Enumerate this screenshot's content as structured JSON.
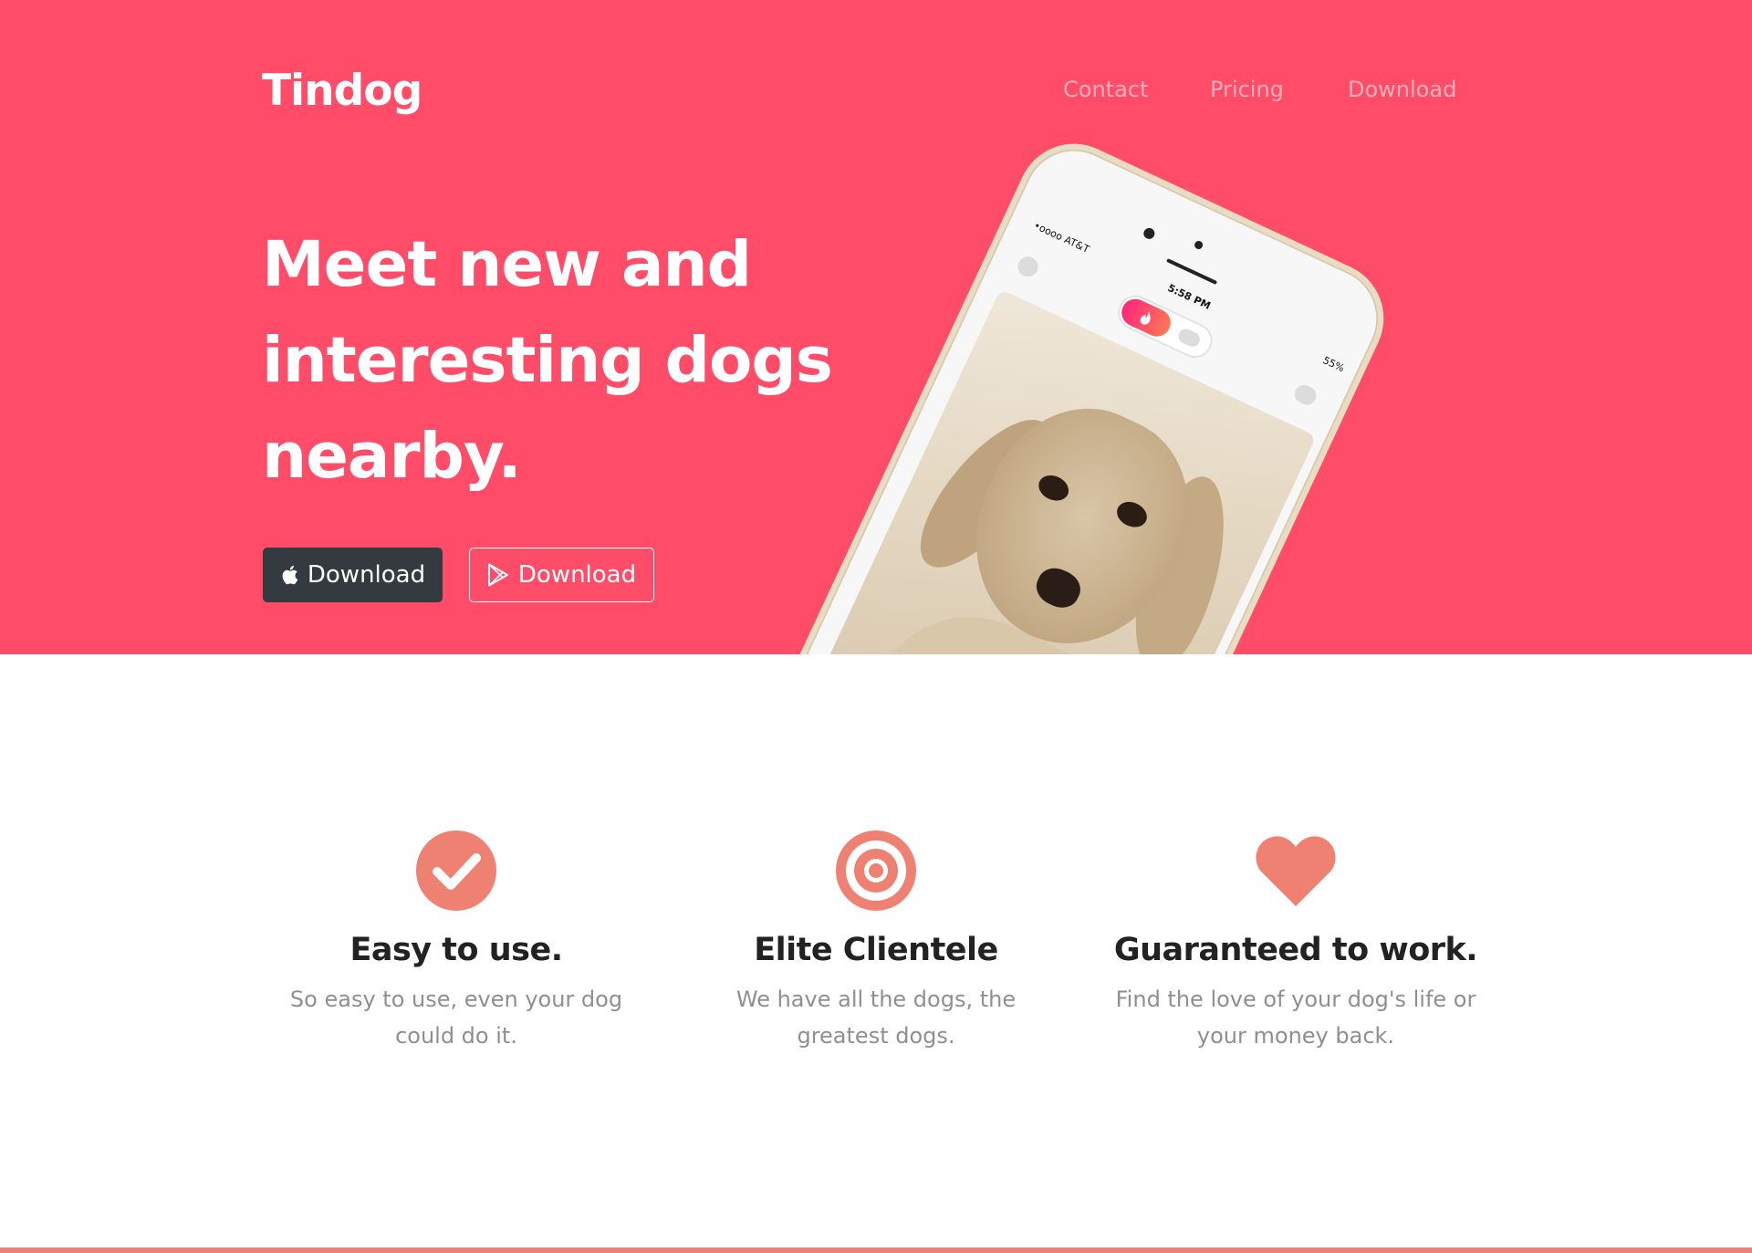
{
  "header": {
    "brand": "Tindog",
    "nav": [
      {
        "label": "Contact"
      },
      {
        "label": "Pricing"
      },
      {
        "label": "Download"
      }
    ]
  },
  "hero": {
    "headline": "Meet new and interesting dogs nearby.",
    "buttons": {
      "apple_download": "Download",
      "play_download": "Download"
    },
    "phone": {
      "carrier": "•oooo AT&T",
      "time": "5:58 PM",
      "battery": "55%"
    }
  },
  "features": [
    {
      "icon": "check-circle-icon",
      "title": "Easy to use.",
      "text": "So easy to use, even your dog could do it."
    },
    {
      "icon": "bullseye-icon",
      "title": "Elite Clientele",
      "text": "We have all the dogs, the greatest dogs."
    },
    {
      "icon": "heart-icon",
      "title": "Guaranteed to work.",
      "text": "Find the love of your dog's life or your money back."
    }
  ],
  "colors": {
    "hero_bg": "#ff4c68",
    "icon_accent": "#ef8172",
    "dark_button": "#343a40"
  }
}
